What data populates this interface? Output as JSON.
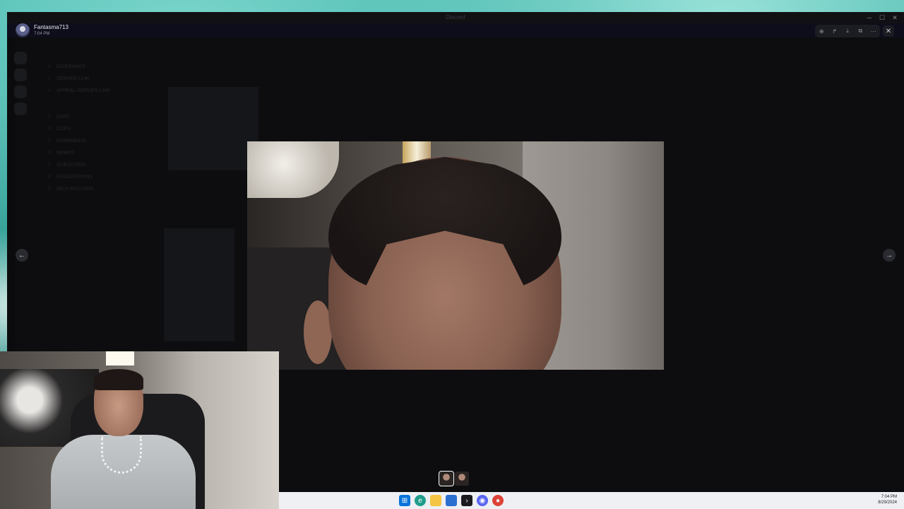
{
  "window": {
    "title": "Discord"
  },
  "viewer": {
    "user_name": "Fantasma713",
    "timestamp": "7:04 PM",
    "tools": [
      "zoom-in-icon",
      "share-icon",
      "download-icon",
      "open-external-icon",
      "more-icon"
    ],
    "close_symbol": "✕",
    "prev_symbol": "←",
    "next_symbol": "→"
  },
  "background_channels": [
    "GIVEAWAYS",
    "SERVER-LINK",
    "APPEAL-SERVER-LINK",
    "CHAT",
    "CLIPS",
    "COMMANDS",
    "MEMES",
    "QUESTIONS",
    "SUGGESTIONS",
    "SELF-ROLLERS"
  ],
  "taskbar": {
    "time": "7:04 PM",
    "date": "8/29/2024",
    "apps": [
      "windows-start-icon",
      "edge-icon",
      "file-explorer-icon",
      "store-icon",
      "terminal-icon",
      "discord-icon",
      "chrome-icon"
    ]
  }
}
